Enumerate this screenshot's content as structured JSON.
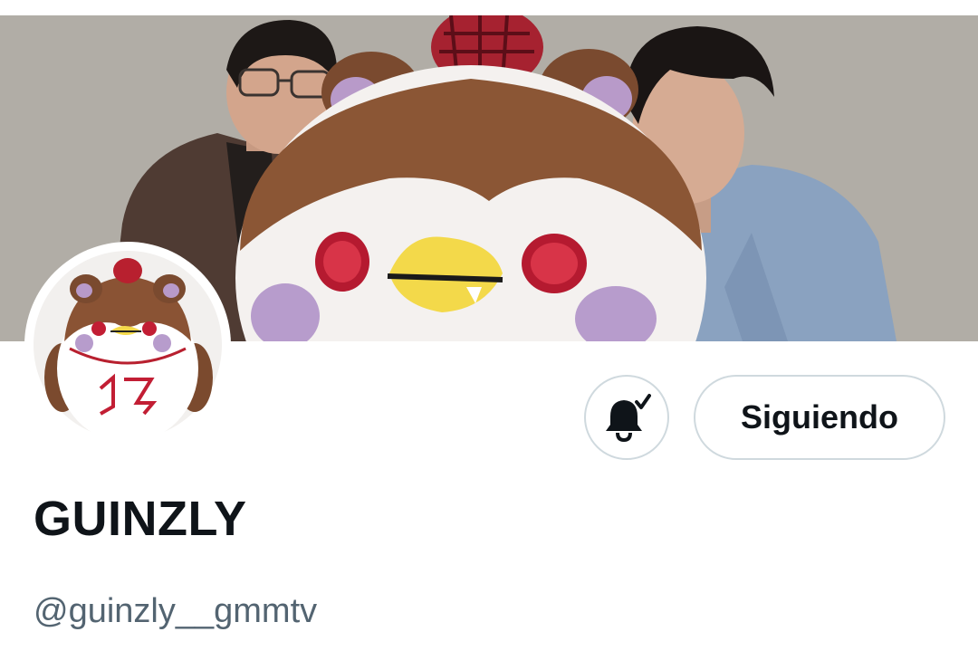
{
  "profile": {
    "display_name": "GUINZLY",
    "handle": "@guinzly__gmmtv"
  },
  "actions": {
    "notifications_icon": "bell-check-icon",
    "follow_label": "Siguiendo"
  },
  "colors": {
    "text_primary": "#0f1419",
    "text_secondary": "#536471",
    "button_border": "#cfd9de",
    "background": "#ffffff"
  }
}
